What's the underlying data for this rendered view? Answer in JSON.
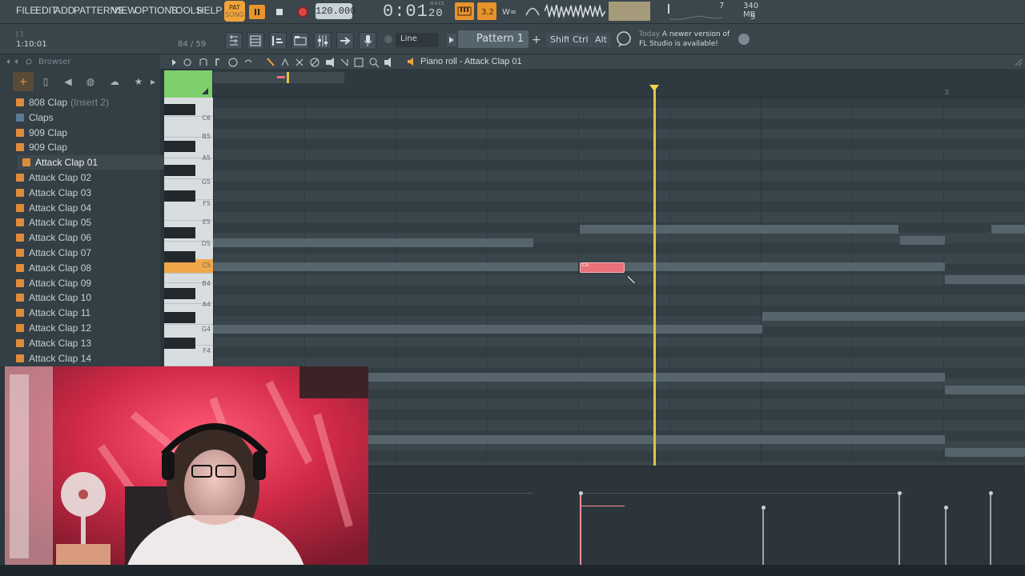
{
  "menu": [
    "FILE",
    "EDIT",
    "ADD",
    "PATTERNS",
    "VIEW",
    "OPTIONS",
    "TOOLS",
    "HELP"
  ],
  "transport": {
    "pat_label": "PAT",
    "song_label": "SONG",
    "tempo": "120.000",
    "time_main": "0:01",
    "time_frac": "20",
    "time_unit": "M:S:CS"
  },
  "system": {
    "cpu_a": "7",
    "mem": "340 MB",
    "cpu_b": "5"
  },
  "hint": {
    "position": "1:10:01",
    "count": "84 / 59"
  },
  "toolbar": {
    "snap": "Line",
    "pattern": "Pattern 1",
    "shift": "Shift",
    "ctrl": "Ctrl",
    "alt": "Alt",
    "news_today": "Today",
    "news_text": "A newer version of FL Studio is available!"
  },
  "browser": {
    "title": "Browser",
    "items": [
      {
        "label": "808 Clap",
        "extra": "(Insert 2)"
      },
      {
        "label": "Claps",
        "folder": true
      },
      {
        "label": "909 Clap"
      },
      {
        "label": "909 Clap"
      },
      {
        "label": "Attack Clap 01",
        "selected": true
      },
      {
        "label": "Attack Clap 02"
      },
      {
        "label": "Attack Clap 03"
      },
      {
        "label": "Attack Clap 04"
      },
      {
        "label": "Attack Clap 05"
      },
      {
        "label": "Attack Clap 06"
      },
      {
        "label": "Attack Clap 07"
      },
      {
        "label": "Attack Clap 08"
      },
      {
        "label": "Attack Clap 09"
      },
      {
        "label": "Attack Clap 10"
      },
      {
        "label": "Attack Clap 11"
      },
      {
        "label": "Attack Clap 12"
      },
      {
        "label": "Attack Clap 13"
      },
      {
        "label": "Attack Clap 14"
      }
    ]
  },
  "piano_roll": {
    "title": "Piano roll - Attack Clap 01",
    "ruler_bar_2": "2",
    "keys": [
      "C6",
      "B5",
      "A5",
      "G5",
      "F5",
      "E5",
      "D5",
      "C5",
      "B4",
      "A4",
      "G4",
      "F4"
    ],
    "note_label": "C5"
  }
}
